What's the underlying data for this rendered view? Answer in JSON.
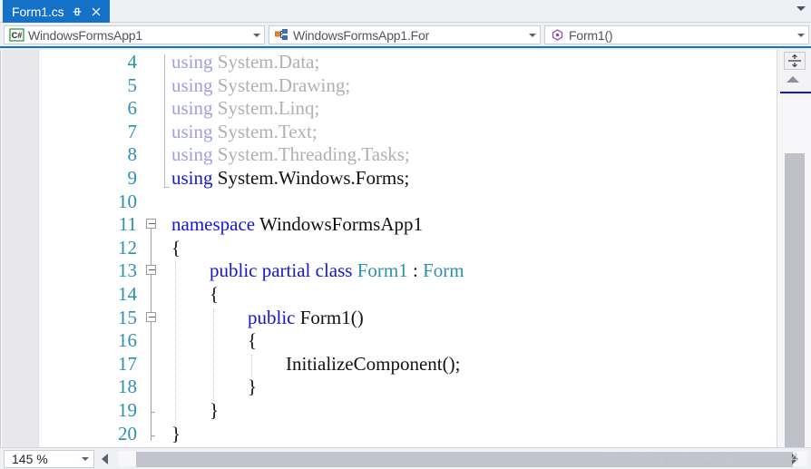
{
  "tab": {
    "label": "Form1.cs",
    "pin_icon": "pin-icon",
    "close_icon": "close-icon",
    "scroll_icon": "chevron-down-icon"
  },
  "navbar": {
    "project": {
      "label": "WindowsFormsApp1",
      "icon": "csharp-project-icon"
    },
    "type": {
      "label": "WindowsFormsApp1.For",
      "icon": "class-icon"
    },
    "member": {
      "label": "Form1()",
      "icon": "method-icon"
    },
    "dropdown_icon": "chevron-down-icon"
  },
  "editor": {
    "first_line": 4,
    "lines": [
      {
        "n": 4,
        "indent": 0,
        "tokens": [
          {
            "t": "using",
            "c": "dim-kw"
          },
          {
            "t": " System.Data;",
            "c": "dim"
          }
        ]
      },
      {
        "n": 5,
        "indent": 0,
        "tokens": [
          {
            "t": "using",
            "c": "dim-kw"
          },
          {
            "t": " System.Drawing;",
            "c": "dim"
          }
        ]
      },
      {
        "n": 6,
        "indent": 0,
        "tokens": [
          {
            "t": "using",
            "c": "dim-kw"
          },
          {
            "t": " System.Linq;",
            "c": "dim"
          }
        ]
      },
      {
        "n": 7,
        "indent": 0,
        "tokens": [
          {
            "t": "using",
            "c": "dim-kw"
          },
          {
            "t": " System.Text;",
            "c": "dim"
          }
        ]
      },
      {
        "n": 8,
        "indent": 0,
        "tokens": [
          {
            "t": "using",
            "c": "dim-kw"
          },
          {
            "t": " System.Threading.Tasks;",
            "c": "dim"
          }
        ]
      },
      {
        "n": 9,
        "indent": 0,
        "tokens": [
          {
            "t": "using",
            "c": "kw"
          },
          {
            "t": " System.Windows.Forms;",
            "c": "plain"
          }
        ]
      },
      {
        "n": 10,
        "indent": 0,
        "tokens": []
      },
      {
        "n": 11,
        "indent": 0,
        "tokens": [
          {
            "t": "namespace",
            "c": "kw"
          },
          {
            "t": " WindowsFormsApp1",
            "c": "plain"
          }
        ]
      },
      {
        "n": 12,
        "indent": 0,
        "tokens": [
          {
            "t": "{",
            "c": "plain"
          }
        ]
      },
      {
        "n": 13,
        "indent": 1,
        "tokens": [
          {
            "t": "public partial class",
            "c": "kw"
          },
          {
            "t": " ",
            "c": "plain"
          },
          {
            "t": "Form1",
            "c": "type"
          },
          {
            "t": " : ",
            "c": "plain"
          },
          {
            "t": "Form",
            "c": "type"
          }
        ]
      },
      {
        "n": 14,
        "indent": 1,
        "tokens": [
          {
            "t": "{",
            "c": "plain"
          }
        ]
      },
      {
        "n": 15,
        "indent": 2,
        "tokens": [
          {
            "t": "public",
            "c": "kw"
          },
          {
            "t": " Form1()",
            "c": "plain"
          }
        ]
      },
      {
        "n": 16,
        "indent": 2,
        "tokens": [
          {
            "t": "{",
            "c": "plain"
          }
        ]
      },
      {
        "n": 17,
        "indent": 3,
        "tokens": [
          {
            "t": "InitializeComponent();",
            "c": "plain"
          }
        ]
      },
      {
        "n": 18,
        "indent": 2,
        "tokens": [
          {
            "t": "}",
            "c": "plain"
          }
        ]
      },
      {
        "n": 19,
        "indent": 1,
        "tokens": [
          {
            "t": "}",
            "c": "plain"
          }
        ]
      },
      {
        "n": 20,
        "indent": 0,
        "tokens": [
          {
            "t": "}",
            "c": "plain"
          }
        ]
      }
    ],
    "outlining": [
      {
        "line": 11,
        "state": "expanded"
      },
      {
        "line": 13,
        "state": "expanded"
      },
      {
        "line": 15,
        "state": "expanded"
      }
    ]
  },
  "scrollbar": {
    "split_icon": "split-view-icon",
    "up_icon": "caret-up-icon",
    "left_icon": "caret-left-icon",
    "right_icon": "caret-right-icon"
  },
  "bottombar": {
    "zoom": "145 %",
    "zoom_arrow_icon": "chevron-down-icon",
    "watermark": "https://blog.csdn.net/qq_36739984"
  },
  "colors": {
    "accent": "#1471c8",
    "keyword": "#1616cf",
    "type": "#2b91af",
    "lineno": "#2b91af",
    "dim": "#b0b0b0"
  }
}
